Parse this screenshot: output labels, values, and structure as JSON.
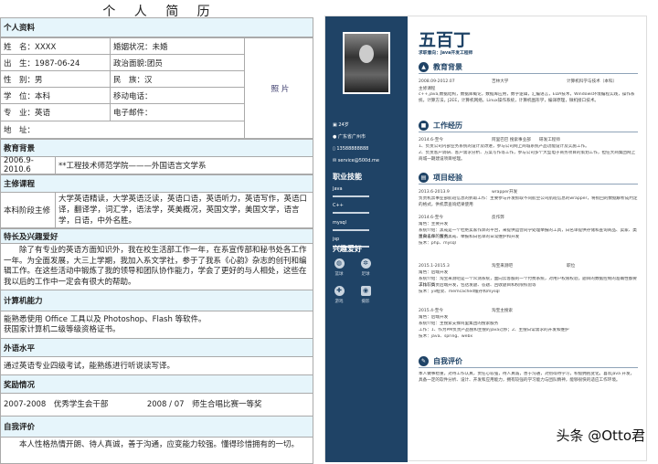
{
  "left_resume": {
    "title": "个 人 简 历",
    "personal_header": "个人资料",
    "fields": {
      "name": "姓　名：XXXX",
      "birth": "出　生：1987-06-24",
      "gender": "性　别：男",
      "degree": "学　位：本科",
      "major": "专　业：英语",
      "address": "地　址：",
      "marital": "婚姻状况：未婚",
      "political": "政治面貌:团员",
      "ethnicity": "民　族：汉",
      "mobile": "移动电话：",
      "email": "电子邮件："
    },
    "photo": "照 片",
    "education_header": "教育背景",
    "education_period": "2006.9-2010.6",
    "education_school": "**工程技术师范学院———外国语言文学系",
    "courses_header": "主修课程",
    "courses_label": "本科阶段主修",
    "courses_text": "大学英语精读，大学英语泛读，英语口语，英语听力，英语写作，英语口译，翻译学，词汇学，语法学，英美概况，英国文学，美国文学，语言学，日语，中外名胜。",
    "hobby_header": "特长及兴趣爱好",
    "hobby_text": "除了有专业的英语方面知识外，我在校生活部工作一年，在系宣传部和秘书处各工作一年。为全面发展，大三上学期，我加入系文学社，参于了我系《心韵》杂志的创刊和编辑工作。在这些活动中锻炼了我的领导和团队协作能力，学会了更好的与人相处，这些在我以后的工作中一定会有很大的帮助。",
    "computer_header": "计算机能力",
    "computer_lines": [
      "能熟悉使用 Office 工具以及 Photoshop、Flash 等软件。",
      "获国家计算机二级等级资格证书。"
    ],
    "language_header": "外语水平",
    "language_text": "通过英语专业四级考试，能熟练进行听说读写译。",
    "awards_header": "奖励情况",
    "awards_text": "2007-2008　优秀学生会干部　　　　　2008 / 07　师生合唱比赛一等奖",
    "self_header": "自我评价",
    "self_text": "本人性格热情开朗、待人真诚，善于沟通，应变能力较强。懂得珍惜拥有的一切。"
  },
  "right_resume": {
    "name": "五百丁",
    "objective": "求职意向：Java开发工程师",
    "contact": [
      "24岁",
      "广东省广州市",
      "13588888888",
      "service@500d.me"
    ],
    "skills_title": "职业技能",
    "skills": [
      {
        "name": "Java",
        "level": 1
      },
      {
        "name": "C++",
        "level": 1
      },
      {
        "name": "mysql",
        "level": 1
      },
      {
        "name": "jsp",
        "level": 1
      }
    ],
    "hobbies_title": "兴趣爱好",
    "hobbies": [
      "篮球",
      "足球",
      "游戏",
      "摄影"
    ],
    "edu_title": "教育背景",
    "edu_line": [
      "2008.09-2012.07",
      "吉林大学",
      "计算机科学与技术（本科）"
    ],
    "edu_course_label": "主修课程",
    "edu_courses": "c++,java,数据结构，数据库概论，数据库应用，数字逻辑，汇编语言，EDA技术，Windows环境编程实践，操作系统，计算方法，J2EE，计算机网络，Linux操作系统，计算机图形学，编译原理，微机接口技术。",
    "work_title": "工作经历",
    "work_line": [
      "2014.6-至今",
      "阿里巴巴 搜索事业部",
      "研发工程师"
    ],
    "work_items": [
      "1、负责公司内部业务系统的设计及改进，参与公司网上商城系统产品功能设计及实施工作。",
      "2、负责客户调研、客户需求分析、方案写作等工作，参与公司多个大型电子商务项目的策划工作，担任大商集团网上商城一期建设项目经理。"
    ],
    "project_title": "项目经验",
    "projects": [
      {
        "head": [
          "2013.6-2013.9",
          "wrapper开发",
          ""
        ],
        "lines": [
          "负责机票事业部航班信息的抓取工作：主要参与开发抓取不同航空公司航班信息的wrapper，将抓回的数据解析成约定的格式，供机票查询结果使用"
        ]
      },
      {
        "head": [
          "2014.6-至今",
          "反作弊",
          ""
        ],
        "lines": [
          "角色：主要开发",
          "系统介绍：黑戒是一个杜绝卖家作弊的平台，来提供运营同学处理举报的工具，白名单提供存储和查询商品、卖家、类目白名单的服务",
          "主要工作：负责黑戒、举报和白名单的日常维护和开发",
          "技术：php、mysql"
        ]
      },
      {
        "head": [
          "2015.1-2015.3",
          "淘宝来测吧",
          "职位"
        ],
        "lines": [
          "角色：后端开发",
          "系统介绍：淘宝来测吧是一个众测系统，面向云客服的一个付费系统，对用户权限校验，题目的数据控制的准确性都要求比较高",
          "工作：负责后端开发，包括发题、答题、回收题目和权限校验等",
          "技术：yii框架、memcached缓存和mysql"
        ]
      },
      {
        "head": [
          "2015.4-至今",
          "淘宝主搜索",
          ""
        ],
        "lines": [
          "角色：后端开发",
          "系统介绍：主搜索支撑阿里集团的搜索服务",
          "工作：1、作为PM负责产品搜和主搜的java迁移；2、主搜日常需求的开发和维护",
          "技术：java、spring、webx"
        ]
      }
    ],
    "self_title": "自我评价",
    "self_text": "本人做事稳重，对待工作认真，责任心较强，待人真诚，善于沟通，对别得待学习，积极拥抱变化。喜欢java 开发，具备一定的软件分析、设计、开发和应用能力，拥有较强的学习能力与团队精神，能够很快的适应工作环境。"
  },
  "watermark": "头条 @Otto君"
}
